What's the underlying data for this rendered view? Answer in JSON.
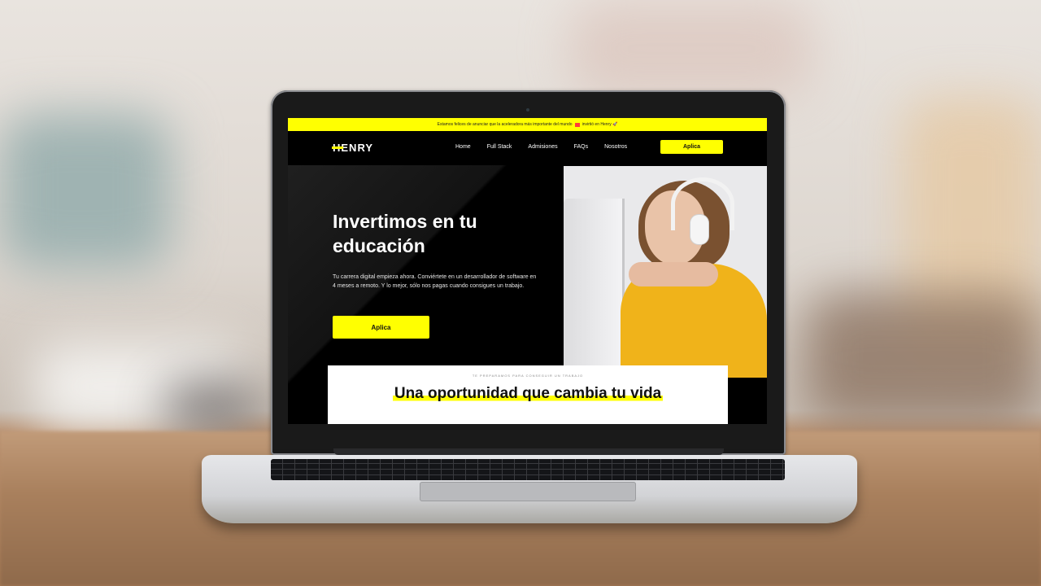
{
  "site": {
    "announcement": {
      "text": "Estamos felices de anunciar que la aceleradora más importante del mundo",
      "brand": "",
      "suffix": "invirtió en Henry 🚀"
    },
    "logo": "HENRY",
    "nav": {
      "items": [
        "Home",
        "Full Stack",
        "Admisiones",
        "FAQs",
        "Nosotros"
      ],
      "cta": "Aplica"
    },
    "hero": {
      "title": "Invertimos en tu educación",
      "description": "Tu carrera digital empieza ahora. Conviértete en un desarrollador de software en 4 meses a remoto. Y lo mejor, sólo nos pagas cuando consigues un trabajo.",
      "cta": "Aplica"
    },
    "card": {
      "eyebrow": "TE PREPARAMOS PARA CONSEGUIR UN TRABAJO",
      "title": "Una oportunidad que cambia tu vida"
    }
  },
  "colors": {
    "accent": "#ffff01",
    "hero_bg": "#000000",
    "text_light": "#ffffff"
  },
  "icons": [
    "camera-icon",
    "rocket-icon"
  ]
}
